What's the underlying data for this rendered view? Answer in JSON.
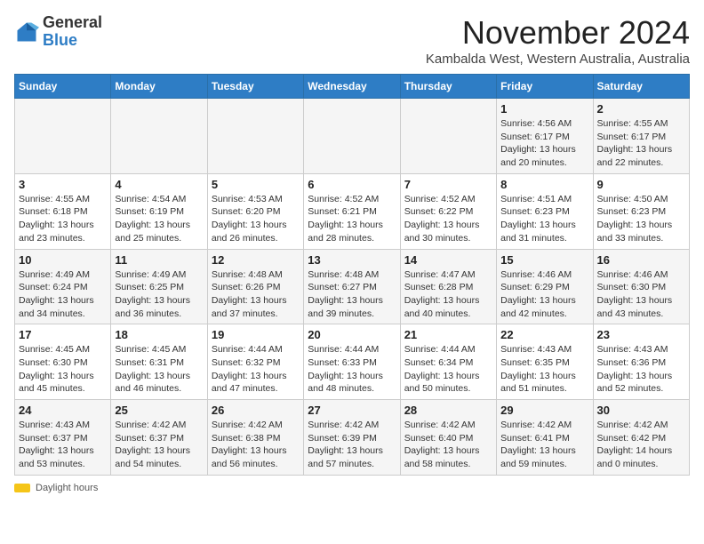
{
  "logo": {
    "general": "General",
    "blue": "Blue"
  },
  "title": "November 2024",
  "subtitle": "Kambalda West, Western Australia, Australia",
  "days_of_week": [
    "Sunday",
    "Monday",
    "Tuesday",
    "Wednesday",
    "Thursday",
    "Friday",
    "Saturday"
  ],
  "footer_daylight": "Daylight hours",
  "weeks": [
    [
      {
        "day": "",
        "info": ""
      },
      {
        "day": "",
        "info": ""
      },
      {
        "day": "",
        "info": ""
      },
      {
        "day": "",
        "info": ""
      },
      {
        "day": "",
        "info": ""
      },
      {
        "day": "1",
        "info": "Sunrise: 4:56 AM\nSunset: 6:17 PM\nDaylight: 13 hours and 20 minutes."
      },
      {
        "day": "2",
        "info": "Sunrise: 4:55 AM\nSunset: 6:17 PM\nDaylight: 13 hours and 22 minutes."
      }
    ],
    [
      {
        "day": "3",
        "info": "Sunrise: 4:55 AM\nSunset: 6:18 PM\nDaylight: 13 hours and 23 minutes."
      },
      {
        "day": "4",
        "info": "Sunrise: 4:54 AM\nSunset: 6:19 PM\nDaylight: 13 hours and 25 minutes."
      },
      {
        "day": "5",
        "info": "Sunrise: 4:53 AM\nSunset: 6:20 PM\nDaylight: 13 hours and 26 minutes."
      },
      {
        "day": "6",
        "info": "Sunrise: 4:52 AM\nSunset: 6:21 PM\nDaylight: 13 hours and 28 minutes."
      },
      {
        "day": "7",
        "info": "Sunrise: 4:52 AM\nSunset: 6:22 PM\nDaylight: 13 hours and 30 minutes."
      },
      {
        "day": "8",
        "info": "Sunrise: 4:51 AM\nSunset: 6:23 PM\nDaylight: 13 hours and 31 minutes."
      },
      {
        "day": "9",
        "info": "Sunrise: 4:50 AM\nSunset: 6:23 PM\nDaylight: 13 hours and 33 minutes."
      }
    ],
    [
      {
        "day": "10",
        "info": "Sunrise: 4:49 AM\nSunset: 6:24 PM\nDaylight: 13 hours and 34 minutes."
      },
      {
        "day": "11",
        "info": "Sunrise: 4:49 AM\nSunset: 6:25 PM\nDaylight: 13 hours and 36 minutes."
      },
      {
        "day": "12",
        "info": "Sunrise: 4:48 AM\nSunset: 6:26 PM\nDaylight: 13 hours and 37 minutes."
      },
      {
        "day": "13",
        "info": "Sunrise: 4:48 AM\nSunset: 6:27 PM\nDaylight: 13 hours and 39 minutes."
      },
      {
        "day": "14",
        "info": "Sunrise: 4:47 AM\nSunset: 6:28 PM\nDaylight: 13 hours and 40 minutes."
      },
      {
        "day": "15",
        "info": "Sunrise: 4:46 AM\nSunset: 6:29 PM\nDaylight: 13 hours and 42 minutes."
      },
      {
        "day": "16",
        "info": "Sunrise: 4:46 AM\nSunset: 6:30 PM\nDaylight: 13 hours and 43 minutes."
      }
    ],
    [
      {
        "day": "17",
        "info": "Sunrise: 4:45 AM\nSunset: 6:30 PM\nDaylight: 13 hours and 45 minutes."
      },
      {
        "day": "18",
        "info": "Sunrise: 4:45 AM\nSunset: 6:31 PM\nDaylight: 13 hours and 46 minutes."
      },
      {
        "day": "19",
        "info": "Sunrise: 4:44 AM\nSunset: 6:32 PM\nDaylight: 13 hours and 47 minutes."
      },
      {
        "day": "20",
        "info": "Sunrise: 4:44 AM\nSunset: 6:33 PM\nDaylight: 13 hours and 48 minutes."
      },
      {
        "day": "21",
        "info": "Sunrise: 4:44 AM\nSunset: 6:34 PM\nDaylight: 13 hours and 50 minutes."
      },
      {
        "day": "22",
        "info": "Sunrise: 4:43 AM\nSunset: 6:35 PM\nDaylight: 13 hours and 51 minutes."
      },
      {
        "day": "23",
        "info": "Sunrise: 4:43 AM\nSunset: 6:36 PM\nDaylight: 13 hours and 52 minutes."
      }
    ],
    [
      {
        "day": "24",
        "info": "Sunrise: 4:43 AM\nSunset: 6:37 PM\nDaylight: 13 hours and 53 minutes."
      },
      {
        "day": "25",
        "info": "Sunrise: 4:42 AM\nSunset: 6:37 PM\nDaylight: 13 hours and 54 minutes."
      },
      {
        "day": "26",
        "info": "Sunrise: 4:42 AM\nSunset: 6:38 PM\nDaylight: 13 hours and 56 minutes."
      },
      {
        "day": "27",
        "info": "Sunrise: 4:42 AM\nSunset: 6:39 PM\nDaylight: 13 hours and 57 minutes."
      },
      {
        "day": "28",
        "info": "Sunrise: 4:42 AM\nSunset: 6:40 PM\nDaylight: 13 hours and 58 minutes."
      },
      {
        "day": "29",
        "info": "Sunrise: 4:42 AM\nSunset: 6:41 PM\nDaylight: 13 hours and 59 minutes."
      },
      {
        "day": "30",
        "info": "Sunrise: 4:42 AM\nSunset: 6:42 PM\nDaylight: 14 hours and 0 minutes."
      }
    ]
  ]
}
